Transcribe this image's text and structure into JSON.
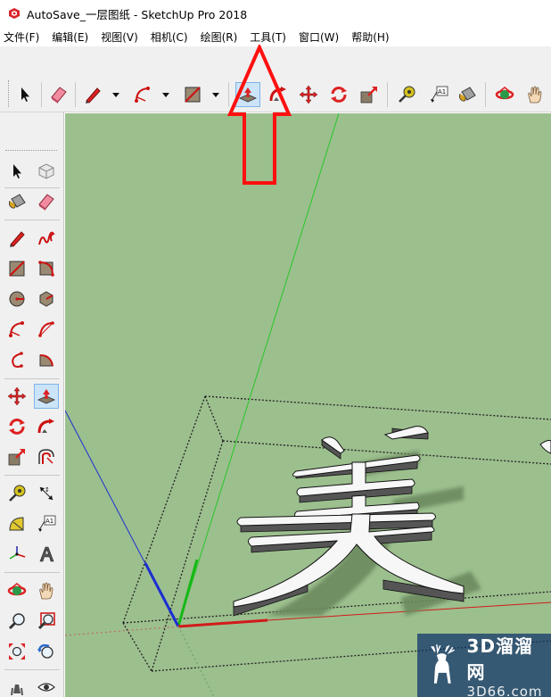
{
  "window": {
    "title": "AutoSave_一层图纸 - SketchUp Pro 2018"
  },
  "menu": [
    {
      "id": "file",
      "label": "文件(F)"
    },
    {
      "id": "edit",
      "label": "编辑(E)"
    },
    {
      "id": "view",
      "label": "视图(V)"
    },
    {
      "id": "camera",
      "label": "相机(C)"
    },
    {
      "id": "draw",
      "label": "绘图(R)"
    },
    {
      "id": "tools",
      "label": "工具(T)"
    },
    {
      "id": "window",
      "label": "窗口(W)"
    },
    {
      "id": "help",
      "label": "帮助(H)"
    }
  ],
  "toolbar_top": [
    {
      "icon": "select-arrow-icon"
    },
    {
      "icon": "eraser-icon"
    },
    {
      "icon": "pencil-icon",
      "has_dropdown": true
    },
    {
      "icon": "arc-icon",
      "has_dropdown": true
    },
    {
      "icon": "rectangle-icon",
      "has_dropdown": true
    },
    {
      "icon": "push-pull-icon",
      "active": true
    },
    {
      "icon": "follow-me-icon"
    },
    {
      "icon": "move-icon"
    },
    {
      "icon": "rotate-icon"
    },
    {
      "icon": "scale-icon"
    },
    {
      "icon": "tape-measure-icon"
    },
    {
      "icon": "text-label-icon",
      "label": "A1"
    },
    {
      "icon": "paint-bucket-icon"
    },
    {
      "icon": "orbit-icon"
    },
    {
      "icon": "pan-hand-icon"
    }
  ],
  "toolbar_left": [
    {
      "icon": "select-arrow-icon"
    },
    {
      "icon": "make-component-icon"
    },
    {
      "icon": "paint-bucket-icon"
    },
    {
      "icon": "eraser-icon"
    },
    {
      "icon": "pencil-icon"
    },
    {
      "icon": "freehand-icon"
    },
    {
      "icon": "rectangle-icon"
    },
    {
      "icon": "rotated-rectangle-icon"
    },
    {
      "icon": "circle-icon"
    },
    {
      "icon": "polygon-icon"
    },
    {
      "icon": "arc-icon"
    },
    {
      "icon": "two-point-arc-icon"
    },
    {
      "icon": "three-point-arc-icon"
    },
    {
      "icon": "pie-icon"
    },
    {
      "icon": "move-icon"
    },
    {
      "icon": "push-pull-icon",
      "active": true
    },
    {
      "icon": "rotate-icon"
    },
    {
      "icon": "follow-me-icon"
    },
    {
      "icon": "scale-icon"
    },
    {
      "icon": "offset-icon"
    },
    {
      "icon": "tape-measure-icon"
    },
    {
      "icon": "dimension-icon"
    },
    {
      "icon": "protractor-icon"
    },
    {
      "icon": "text-icon",
      "label": "A1"
    },
    {
      "icon": "axes-icon"
    },
    {
      "icon": "3d-text-icon",
      "label": "A"
    },
    {
      "icon": "orbit-icon"
    },
    {
      "icon": "pan-hand-icon"
    },
    {
      "icon": "zoom-icon"
    },
    {
      "icon": "zoom-window-icon"
    },
    {
      "icon": "zoom-extents-icon"
    },
    {
      "icon": "previous-view-icon"
    },
    {
      "icon": "walk-icon"
    },
    {
      "icon": "look-around-icon"
    }
  ],
  "scene": {
    "text_3d": "美",
    "background_color": "#9cbf8e",
    "axis_colors": {
      "x": "#d21a1a",
      "y": "#16b816",
      "z": "#1a2fd2"
    }
  },
  "annotation": {
    "color": "#ff1010",
    "points_to": "tools"
  },
  "watermark": {
    "brand": "3D溜溜网",
    "domain": "3D66.com"
  }
}
